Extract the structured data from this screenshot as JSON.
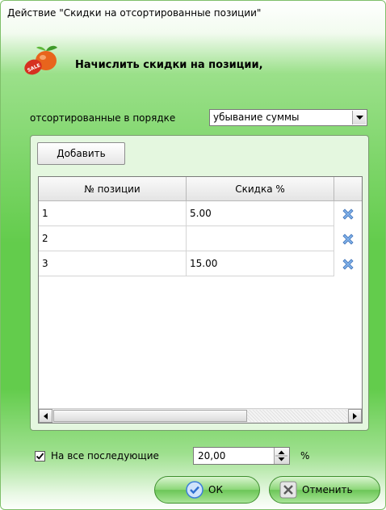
{
  "window": {
    "title": "Действие \"Скидки на отсортированные позиции\""
  },
  "header": {
    "icon": "sale-fruit-icon",
    "text": "Начислить скидки на позиции,"
  },
  "sort": {
    "label": "отсортированные в порядке",
    "selected": "убывание суммы"
  },
  "toolbar": {
    "add_label": "Добавить"
  },
  "table": {
    "columns": [
      "№ позиции",
      "Скидка %"
    ],
    "rows": [
      {
        "position": "1",
        "discount": "5.00"
      },
      {
        "position": "2",
        "discount": ""
      },
      {
        "position": "3",
        "discount": "15.00"
      }
    ]
  },
  "footer": {
    "all_following_label": "На все последующие",
    "all_following_checked": true,
    "all_following_value": "20,00",
    "unit": "%"
  },
  "buttons": {
    "ok_label": "ОК",
    "cancel_label": "Отменить"
  },
  "colors": {
    "accent_green": "#63cc4c",
    "delete_icon": "#5b8fd6",
    "ok_icon": "#3d7fd9"
  }
}
